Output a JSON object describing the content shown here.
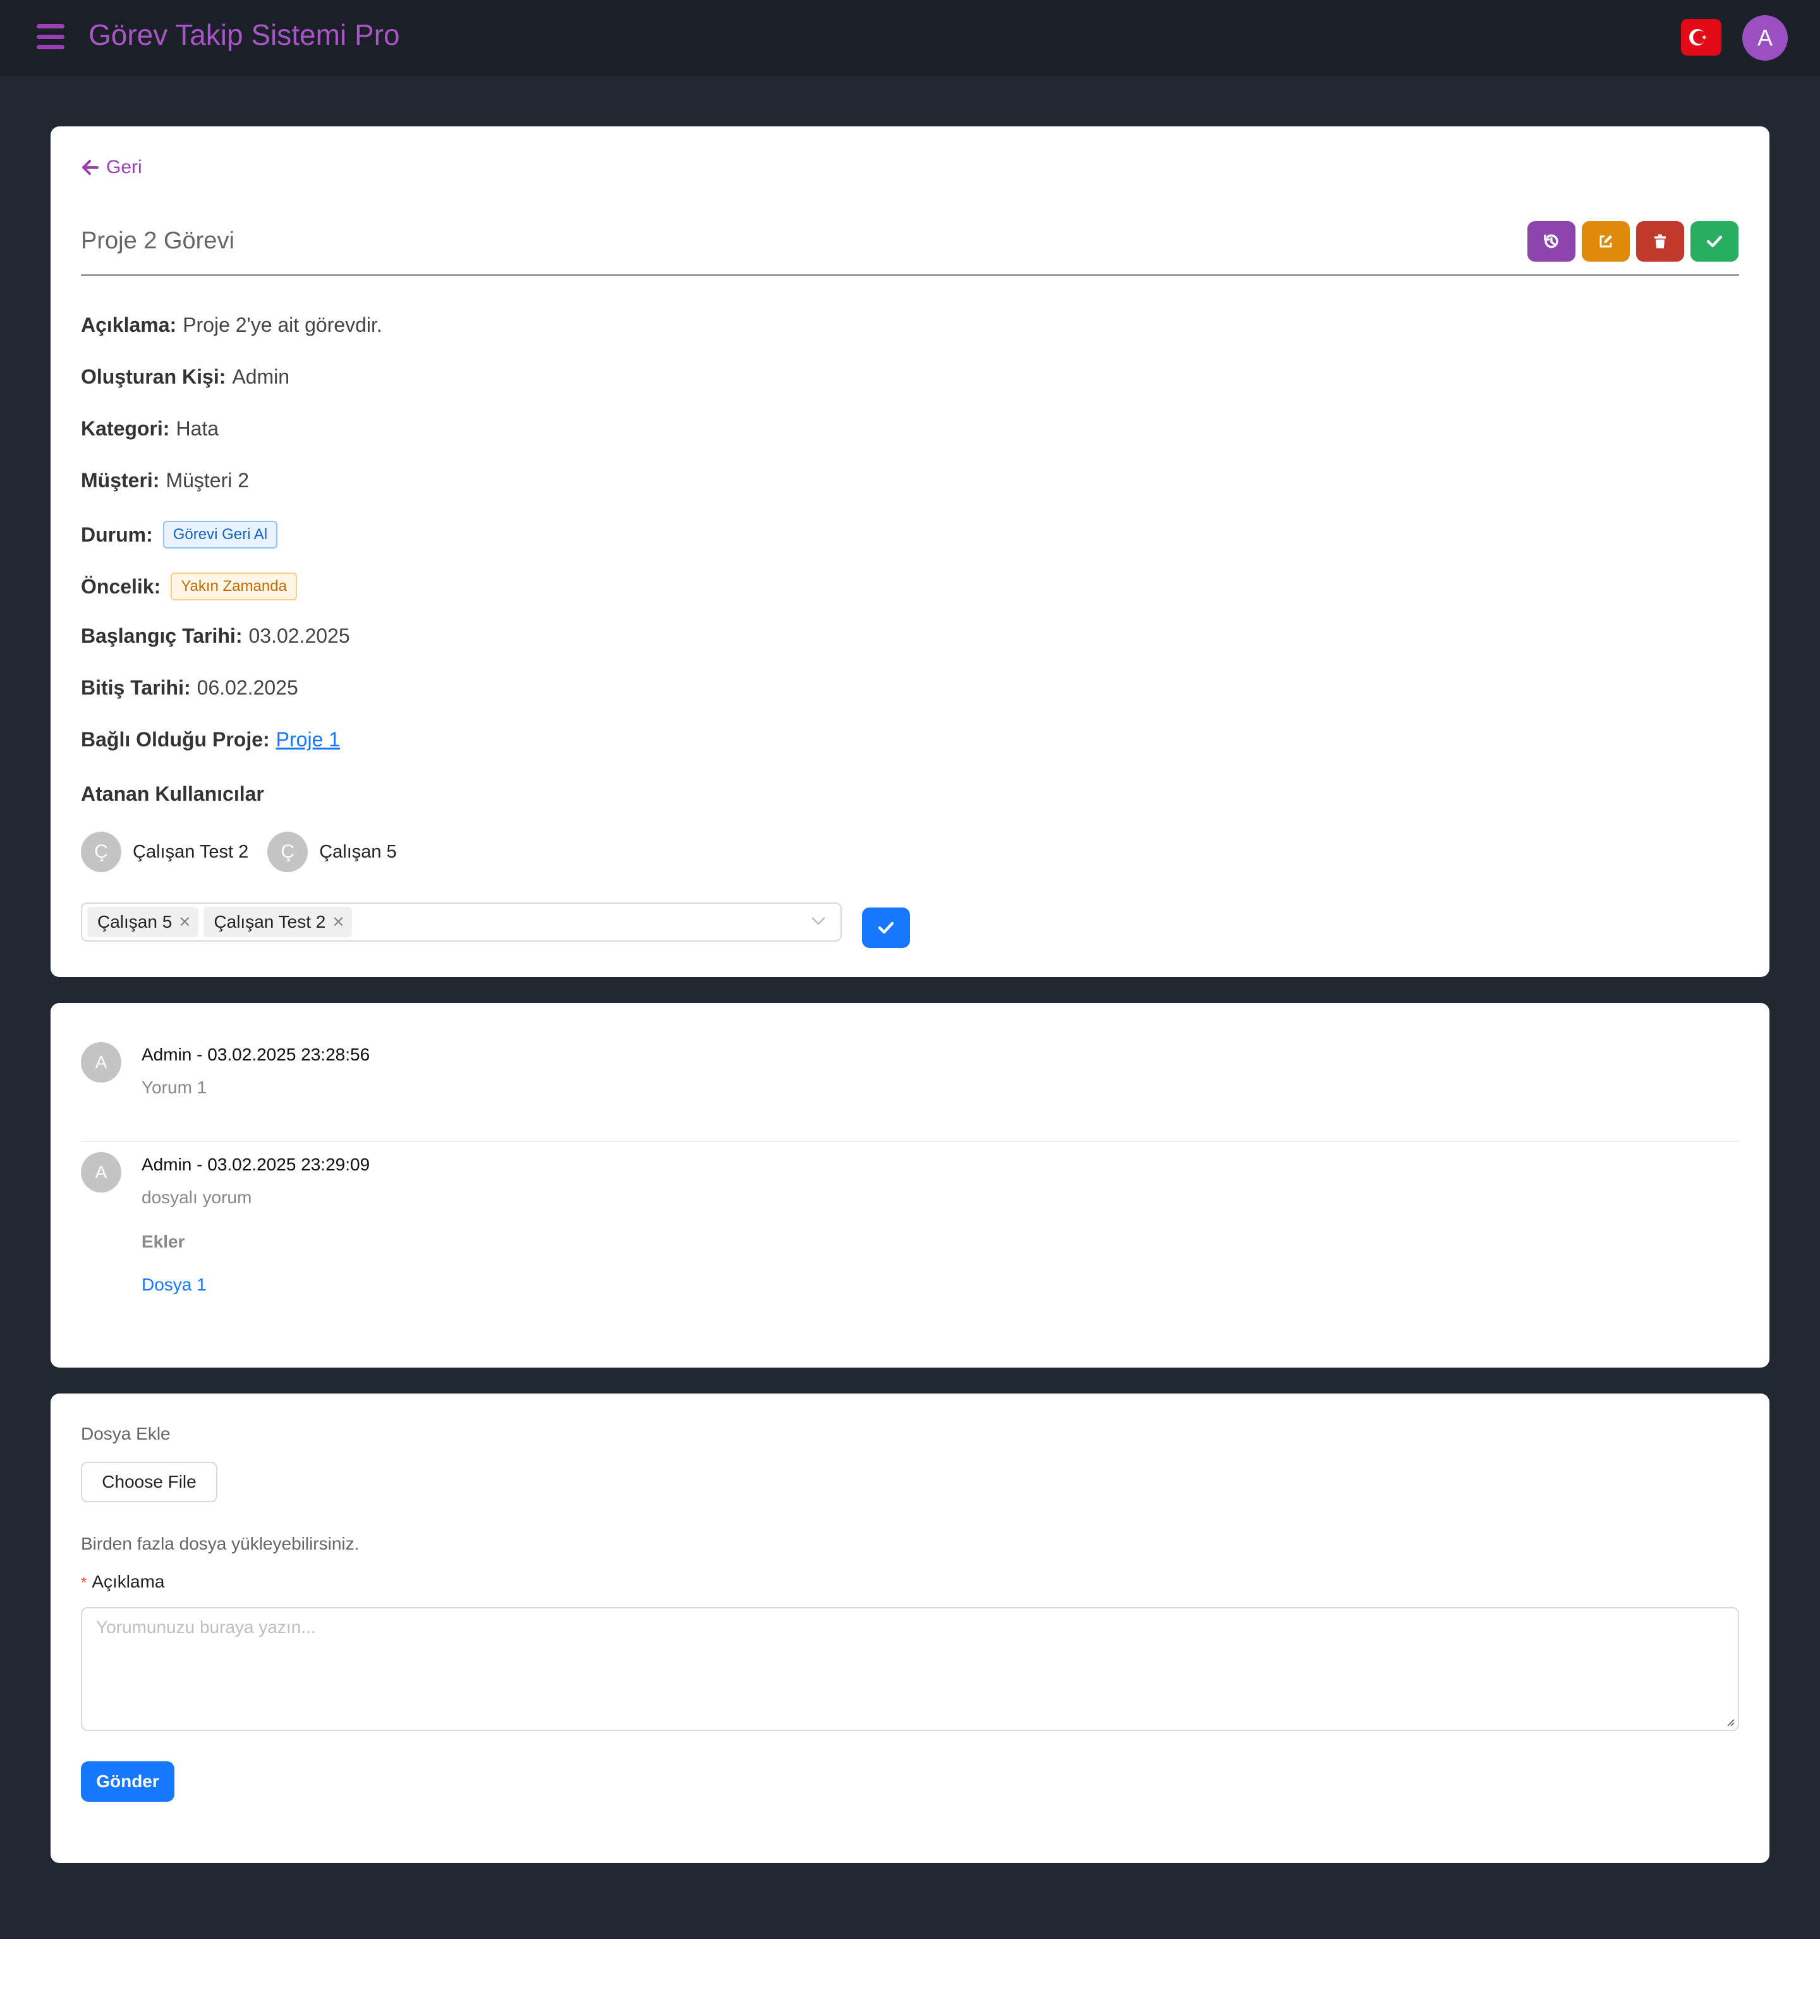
{
  "app": {
    "title": "Görev Takip Sistemi Pro",
    "avatar_initial": "A"
  },
  "colors": {
    "brand_purple": "#9b3fb5",
    "primary_blue": "#1677ff",
    "topbar": "#1b1f27",
    "background": "#222831"
  },
  "task": {
    "back_label": "Geri",
    "title": "Proje 2 Görevi",
    "actions": [
      "history-icon",
      "edit-icon",
      "trash-icon",
      "check-icon"
    ],
    "fields": {
      "description": {
        "label": "Açıklama:",
        "value": "Proje 2'ye ait görevdir."
      },
      "creator": {
        "label": "Oluşturan Kişi:",
        "value": "Admin"
      },
      "category": {
        "label": "Kategori:",
        "value": "Hata"
      },
      "customer": {
        "label": "Müşteri:",
        "value": "Müşteri 2"
      },
      "status": {
        "label": "Durum:",
        "value": "Görevi Geri Al"
      },
      "priority": {
        "label": "Öncelik:",
        "value": "Yakın Zamanda"
      },
      "start_date": {
        "label": "Başlangıç Tarihi:",
        "value": "03.02.2025"
      },
      "end_date": {
        "label": "Bitiş Tarihi:",
        "value": "06.02.2025"
      },
      "project": {
        "label": "Bağlı Olduğu Proje:",
        "value": "Proje 1"
      }
    },
    "assigned_title": "Atanan Kullanıcılar",
    "assigned_users": [
      {
        "initial": "Ç",
        "name": "Çalışan Test 2"
      },
      {
        "initial": "Ç",
        "name": "Çalışan 5"
      }
    ],
    "select_chips": [
      "Çalışan 5",
      "Çalışan Test 2"
    ]
  },
  "comments": [
    {
      "initial": "A",
      "meta": "Admin - 03.02.2025 23:28:56",
      "text": "Yorum 1"
    },
    {
      "initial": "A",
      "meta": "Admin - 03.02.2025 23:29:09",
      "text": "dosyalı yorum",
      "attachments_title": "Ekler",
      "attachments": [
        "Dosya 1"
      ]
    }
  ],
  "form": {
    "file_label": "Dosya Ekle",
    "file_button": "Choose File",
    "file_hint": "Birden fazla dosya yükleyebilirsiniz.",
    "required_mark": "*",
    "desc_label": "Açıklama",
    "desc_placeholder": "Yorumunuzu buraya yazın...",
    "submit": "Gönder"
  }
}
